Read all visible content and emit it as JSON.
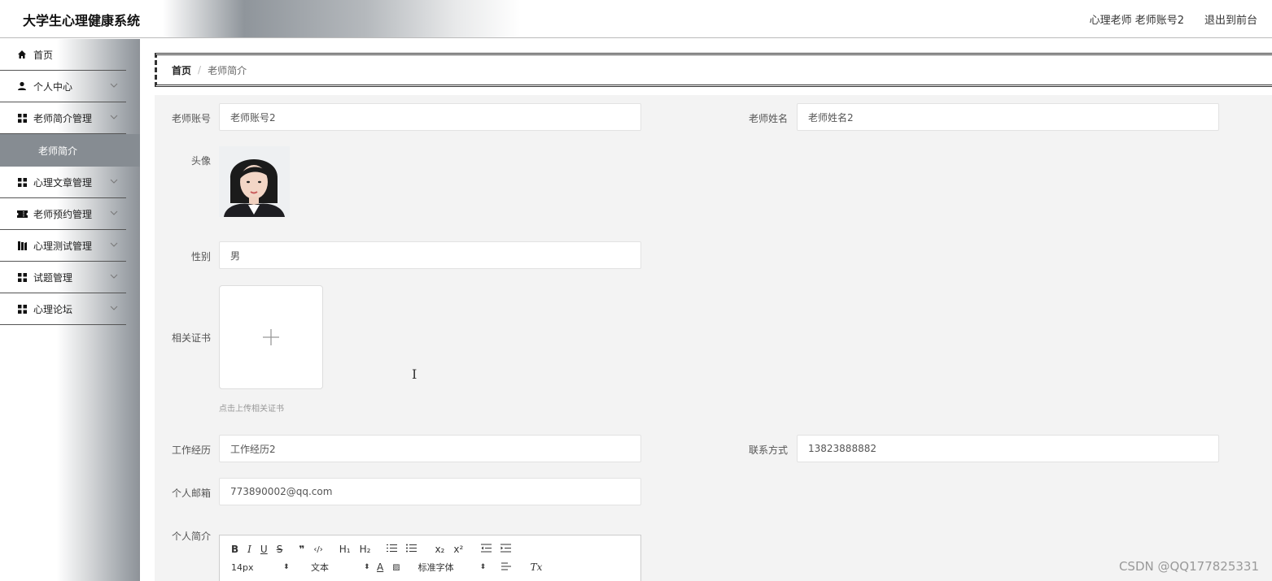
{
  "header": {
    "title": "大学生心理健康系统",
    "user_info": "心理老师 老师账号2",
    "exit_label": "退出到前台"
  },
  "sidebar": {
    "items": [
      {
        "label": "首页",
        "icon": "home-icon"
      },
      {
        "label": "个人中心",
        "icon": "user-icon"
      },
      {
        "label": "老师简介管理",
        "icon": "grid-icon"
      },
      {
        "label": "老师简介",
        "submenu": true
      },
      {
        "label": "心理文章管理",
        "icon": "grid-icon"
      },
      {
        "label": "老师预约管理",
        "icon": "ticket-icon"
      },
      {
        "label": "心理测试管理",
        "icon": "book-icon"
      },
      {
        "label": "试题管理",
        "icon": "grid-icon"
      },
      {
        "label": "心理论坛",
        "icon": "grid-icon"
      }
    ]
  },
  "breadcrumb": {
    "home": "首页",
    "separator": "/",
    "current": "老师简介"
  },
  "form": {
    "teacher_account": {
      "label": "老师账号",
      "value": "老师账号2"
    },
    "teacher_name": {
      "label": "老师姓名",
      "value": "老师姓名2"
    },
    "avatar": {
      "label": "头像"
    },
    "gender": {
      "label": "性别",
      "value": "男"
    },
    "certificate": {
      "label": "相关证书",
      "tip": "点击上传相关证书"
    },
    "work_experience": {
      "label": "工作经历",
      "value": "工作经历2"
    },
    "contact": {
      "label": "联系方式",
      "value": "13823888882"
    },
    "email": {
      "label": "个人邮箱",
      "value": "773890002@qq.com"
    },
    "intro": {
      "label": "个人简介"
    }
  },
  "editor_toolbar": {
    "bold": "B",
    "italic": "I",
    "underline": "U",
    "strike": "S",
    "blockquote": "❞",
    "code": "‹/›",
    "h1": "H₁",
    "h2": "H₂",
    "subscript": "x₂",
    "superscript": "x²",
    "font_size": "14px",
    "header_select": "文本",
    "font_family": "标准字体",
    "clean": "Tx"
  },
  "watermark": "CSDN @QQ177825331",
  "colors": {
    "sidebar_active": "#868c92",
    "content_bg": "#f3f3f3"
  }
}
